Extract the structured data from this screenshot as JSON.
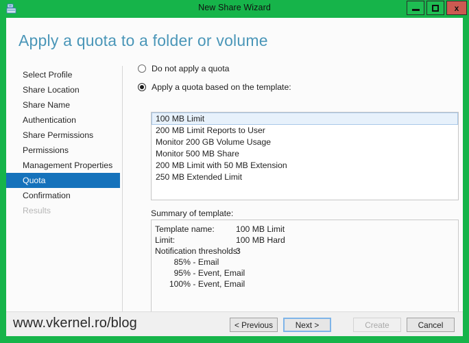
{
  "window": {
    "title": "New Share Wizard",
    "icon": "share-folder-icon",
    "accent_green": "#16b44a",
    "close_red": "#cb5a51",
    "controls": {
      "minimize": "–",
      "maximize": "□",
      "close": "x"
    }
  },
  "page": {
    "heading": "Apply a quota to a folder or volume",
    "heading_color": "#4a96b8"
  },
  "sidebar": {
    "selected_color": "#1572bb",
    "items": [
      {
        "label": "Select Profile",
        "state": "normal"
      },
      {
        "label": "Share Location",
        "state": "normal"
      },
      {
        "label": "Share Name",
        "state": "normal"
      },
      {
        "label": "Authentication",
        "state": "normal"
      },
      {
        "label": "Share Permissions",
        "state": "normal"
      },
      {
        "label": "Permissions",
        "state": "normal"
      },
      {
        "label": "Management Properties",
        "state": "normal"
      },
      {
        "label": "Quota",
        "state": "selected"
      },
      {
        "label": "Confirmation",
        "state": "normal"
      },
      {
        "label": "Results",
        "state": "disabled"
      }
    ]
  },
  "main": {
    "radios": [
      {
        "label": "Do not apply a quota",
        "checked": false
      },
      {
        "label": "Apply a quota based on the template:",
        "checked": true
      }
    ],
    "templates": [
      {
        "label": "100 MB Limit",
        "selected": true
      },
      {
        "label": "200 MB Limit Reports to User",
        "selected": false
      },
      {
        "label": "Monitor 200 GB Volume Usage",
        "selected": false
      },
      {
        "label": "Monitor 500 MB Share",
        "selected": false
      },
      {
        "label": "200 MB Limit with 50 MB Extension",
        "selected": false
      },
      {
        "label": "250 MB Extended Limit",
        "selected": false
      }
    ],
    "summary_label": "Summary of template:",
    "summary": {
      "rows": [
        {
          "key": "Template name:",
          "value": "100 MB Limit"
        },
        {
          "key": "Limit:",
          "value": "100 MB Hard"
        },
        {
          "key": "Notification thresholds:",
          "value": "3"
        }
      ],
      "thresholds": [
        {
          "pct": "85%",
          "actions": "- Email"
        },
        {
          "pct": "95%",
          "actions": "- Event, Email"
        },
        {
          "pct": "100%",
          "actions": "- Event, Email"
        }
      ]
    }
  },
  "footer": {
    "watermark": "www.vkernel.ro/blog",
    "buttons": [
      {
        "label": "< Previous",
        "state": "normal"
      },
      {
        "label": "Next >",
        "state": "focus"
      },
      {
        "label": "Create",
        "state": "disabled"
      },
      {
        "label": "Cancel",
        "state": "normal"
      }
    ]
  }
}
